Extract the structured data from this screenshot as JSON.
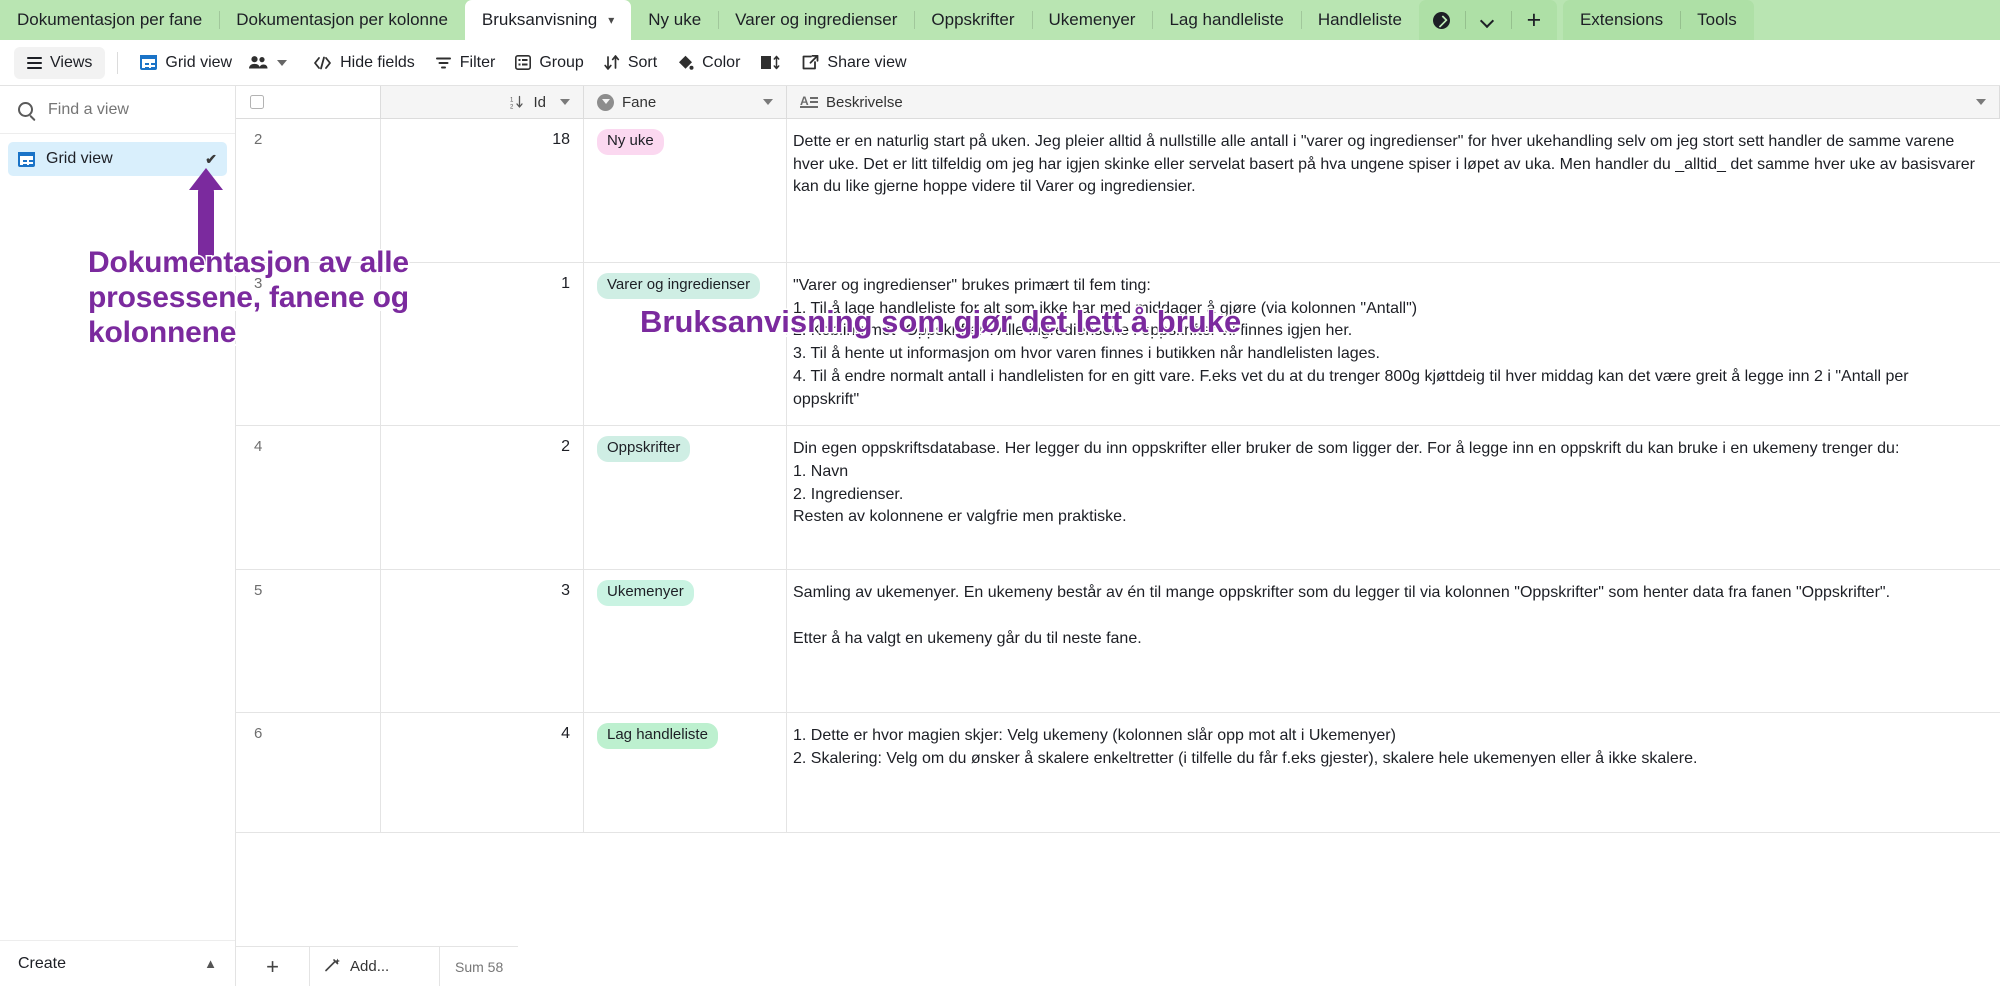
{
  "tabbar": {
    "tabs": [
      {
        "label": "Dokumentasjon per fane",
        "active": false
      },
      {
        "label": "Dokumentasjon per kolonne",
        "active": false
      },
      {
        "label": "Bruksanvisning",
        "active": true
      },
      {
        "label": "Ny uke",
        "active": false
      },
      {
        "label": "Varer og ingredienser",
        "active": false
      },
      {
        "label": "Oppskrifter",
        "active": false
      },
      {
        "label": "Ukemenyer",
        "active": false
      },
      {
        "label": "Lag handleliste",
        "active": false
      },
      {
        "label": "Handleliste",
        "active": false
      }
    ],
    "controls": [
      {
        "name": "expand-tabs-icon",
        "glyph": "circle-arrow"
      },
      {
        "name": "tab-list-dropdown-icon",
        "glyph": "chevron-down"
      },
      {
        "name": "add-table-icon",
        "glyph": "plus"
      }
    ],
    "right_tabs": [
      {
        "label": "Extensions"
      },
      {
        "label": "Tools"
      }
    ],
    "accent_color": "#b9e5b2"
  },
  "toolbar": {
    "views_label": "Views",
    "grid_view_label": "Grid view",
    "buttons": [
      {
        "label": "Hide fields",
        "icon": "hide-fields-icon"
      },
      {
        "label": "Filter",
        "icon": "filter-icon"
      },
      {
        "label": "Group",
        "icon": "group-icon"
      },
      {
        "label": "Sort",
        "icon": "sort-icon"
      },
      {
        "label": "Color",
        "icon": "color-icon"
      },
      {
        "label": "",
        "icon": "row-height-icon"
      },
      {
        "label": "Share view",
        "icon": "share-icon"
      }
    ]
  },
  "sidebar": {
    "search_placeholder": "Find a view",
    "views": [
      {
        "label": "Grid view",
        "selected": true,
        "checked": true
      }
    ],
    "create_label": "Create"
  },
  "grid": {
    "columns": [
      {
        "label": "Id",
        "icon": "sort-number-icon"
      },
      {
        "label": "Fane",
        "icon": "single-select-icon"
      },
      {
        "label": "Beskrivelse",
        "icon": "long-text-icon"
      }
    ],
    "rows": [
      {
        "num": "2",
        "id": "18",
        "fane": "Ny uke",
        "fane_color": "#fbd8f0",
        "besk": "Dette er en naturlig start på uken. Jeg pleier alltid å nullstille alle antall i \"varer og ingredienser\" for hver ukehandling selv om jeg stort sett handler de samme varene hver uke. Det er litt tilfeldig om jeg har igjen skinke eller servelat basert på hva ungene spiser i løpet av uka. Men handler du _alltid_ det samme hver uke av basisvarer kan du like gjerne hoppe videre til Varer og ingrediensier."
      },
      {
        "num": "3",
        "id": "1",
        "fane": "Varer og ingredienser",
        "fane_color": "#cfeee4",
        "besk": "\"Varer og ingredienser\" brukes primært til fem ting:\n1. Til å lage handleliste for alt som ikke har med middager å gjøre (via kolonnen \"Antall\")\n2. Kobling mot \"Oppskrifter\". Alle ingrediensene i oppskrifter vil finnes igjen her.\n3. Til å hente ut informasjon om hvor varen finnes i butikken når handlelisten lages.\n4. Til å endre normalt antall i handlelisten for en gitt vare. F.eks vet du at du trenger 800g kjøttdeig til hver middag kan det være greit å legge inn 2 i \"Antall per oppskrift\""
      },
      {
        "num": "4",
        "id": "2",
        "fane": "Oppskrifter",
        "fane_color": "#cfeee4",
        "besk": "Din egen oppskriftsdatabase. Her legger du inn oppskrifter eller bruker de som ligger der. For å legge inn en oppskrift du kan bruke i en ukemeny trenger du:\n1. Navn\n2. Ingredienser.\nResten av kolonnene er valgfrie men praktiske."
      },
      {
        "num": "5",
        "id": "3",
        "fane": "Ukemenyer",
        "fane_color": "#c9f3e2",
        "besk": "Samling av ukemenyer. En ukemeny består av én til mange oppskrifter som du legger til via kolonnen \"Oppskrifter\" som henter data fra fanen \"Oppskrifter\".\n\nEtter å ha valgt en ukemeny går du til neste fane."
      },
      {
        "num": "6",
        "id": "4",
        "fane": "Lag handleliste",
        "fane_color": "#bdf0cf",
        "besk": "1. Dette er hvor magien skjer: Velg ukemeny (kolonnen slår opp mot alt i Ukemenyer)\n2. Skalering: Velg om du ønsker å skalere enkeltretter (i tilfelle du får f.eks gjester), skalere hele ukemenyen eller å ikke skalere."
      }
    ],
    "footer": {
      "add_label": "Add...",
      "summary": "Sum 58"
    }
  },
  "annotations": [
    {
      "id": "annotation-sidebar",
      "text": "Dokumentasjon av alle prosessene, fanene og kolonnene",
      "color": "#7b2a9e"
    },
    {
      "id": "annotation-grid",
      "text": "Bruksanvisning som gjør det lett å bruke",
      "color": "#7b2a9e"
    }
  ]
}
